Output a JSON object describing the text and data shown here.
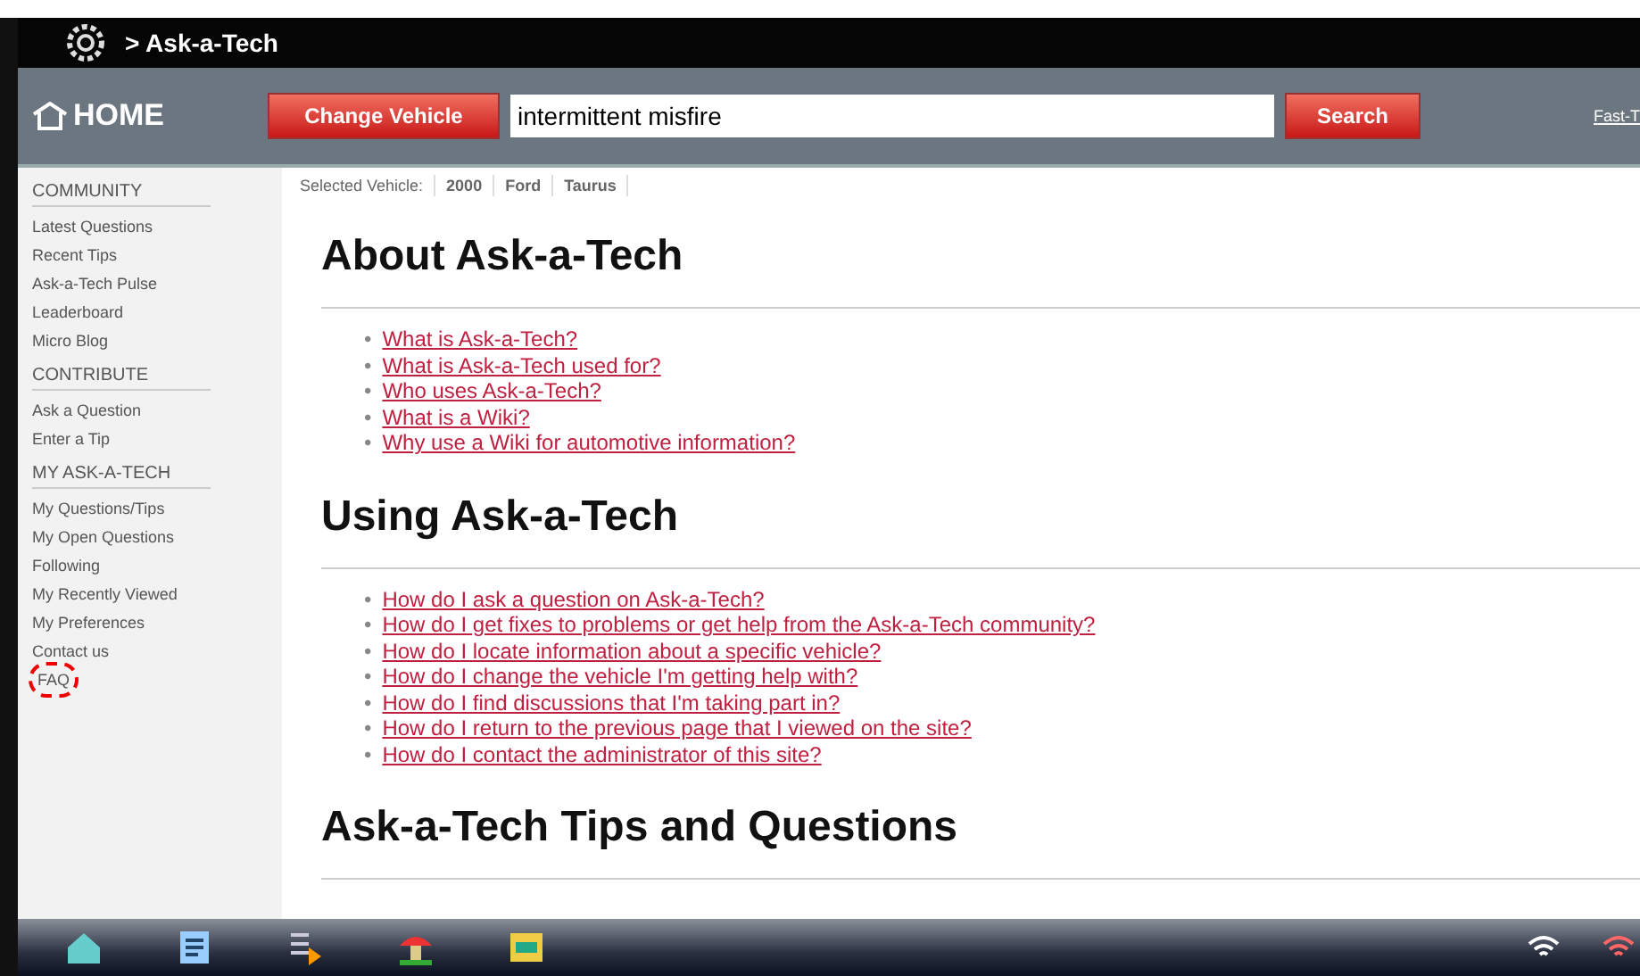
{
  "title_bar": {
    "title": "> Ask-a-Tech"
  },
  "header": {
    "home": "HOME",
    "change_vehicle": "Change Vehicle",
    "search_value": "intermittent misfire",
    "search_button": "Search",
    "link": "Fast-T"
  },
  "sidebar": [
    {
      "heading": "COMMUNITY",
      "items": [
        {
          "label": "Latest Questions",
          "highlighted": false
        },
        {
          "label": "Recent Tips",
          "highlighted": false
        },
        {
          "label": "Ask-a-Tech Pulse",
          "highlighted": false
        },
        {
          "label": "Leaderboard",
          "highlighted": false
        },
        {
          "label": "Micro Blog",
          "highlighted": false
        }
      ]
    },
    {
      "heading": "CONTRIBUTE",
      "items": [
        {
          "label": "Ask a Question",
          "highlighted": false
        },
        {
          "label": "Enter a Tip",
          "highlighted": false
        }
      ]
    },
    {
      "heading": "MY ASK-A-TECH",
      "items": [
        {
          "label": "My Questions/Tips",
          "highlighted": false
        },
        {
          "label": "My Open Questions",
          "highlighted": false
        },
        {
          "label": "Following",
          "highlighted": false
        },
        {
          "label": "My Recently Viewed",
          "highlighted": false
        },
        {
          "label": "My Preferences",
          "highlighted": false
        },
        {
          "label": "Contact us",
          "highlighted": false
        },
        {
          "label": "FAQ",
          "highlighted": true
        }
      ]
    }
  ],
  "selected_vehicle": {
    "label": "Selected Vehicle:",
    "parts": [
      "2000",
      "Ford",
      "Taurus"
    ]
  },
  "sections": [
    {
      "heading": "About Ask-a-Tech",
      "bullet": "•",
      "links": [
        "What is Ask-a-Tech?",
        "What is Ask-a-Tech used for?",
        "Who uses Ask-a-Tech?",
        "What is a Wiki?",
        "Why use a Wiki for automotive information?"
      ]
    },
    {
      "heading": "Using Ask-a-Tech",
      "bullet": "•",
      "links": [
        "How do I ask a question on Ask-a-Tech?",
        "How do I get fixes to problems or get help from the Ask-a-Tech community?",
        "How do I locate information about a specific vehicle?",
        "How do I change the vehicle I'm getting help with?",
        "How do I find discussions that I'm taking part in?",
        "How do I return to the previous page that I viewed on the site?",
        "How do I contact the administrator of this site?"
      ]
    },
    {
      "heading": "Ask-a-Tech Tips and Questions"
    }
  ]
}
